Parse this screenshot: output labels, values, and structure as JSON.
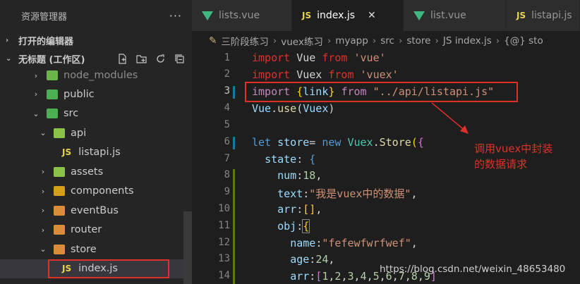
{
  "sidebar": {
    "title": "资源管理器",
    "more": "···",
    "open_editors": "打开的编辑器",
    "workspace": "无标题 (工作区)",
    "tree": [
      {
        "label": "node_modules",
        "arrow": "›",
        "color": "#6bb34b",
        "dim": true
      },
      {
        "label": "public",
        "arrow": "›",
        "color": "#4caf50"
      },
      {
        "label": "src",
        "arrow": "⌄",
        "color": "#4caf50"
      },
      {
        "label": "api",
        "arrow": "⌄",
        "color": "#8bc34a"
      },
      {
        "label": "listapi.js",
        "icon": "JS"
      },
      {
        "label": "assets",
        "arrow": "›",
        "color": "#8bc34a"
      },
      {
        "label": "components",
        "arrow": "›",
        "color": "#d4a017"
      },
      {
        "label": "eventBus",
        "arrow": "›",
        "color": "#d88c3a"
      },
      {
        "label": "router",
        "arrow": "›",
        "color": "#d88c3a"
      },
      {
        "label": "store",
        "arrow": "⌄",
        "color": "#d88c3a"
      },
      {
        "label": "index.js",
        "icon": "JS",
        "selected": true
      }
    ]
  },
  "tabs": [
    {
      "label": "lists.vue",
      "type": "vue"
    },
    {
      "label": "index.js",
      "type": "js",
      "active": true,
      "close": "✕"
    },
    {
      "label": "list.vue",
      "type": "vue"
    },
    {
      "label": "listapi.js",
      "type": "js"
    }
  ],
  "breadcrumbs": [
    "三阶段练习",
    "vuex练习",
    "myapp",
    "src",
    "store",
    "JS index.js",
    "{@} sto"
  ],
  "editor": {
    "line_numbers": [
      "1",
      "2",
      "3",
      "4",
      "5",
      "6",
      "7",
      "8",
      "9",
      "10",
      "11",
      "12",
      "13",
      "14"
    ]
  },
  "annotation": {
    "line1": "调用vuex中封装",
    "line2": "的数据请求"
  },
  "watermark": "https://blog.csdn.net/weixin_48653480"
}
